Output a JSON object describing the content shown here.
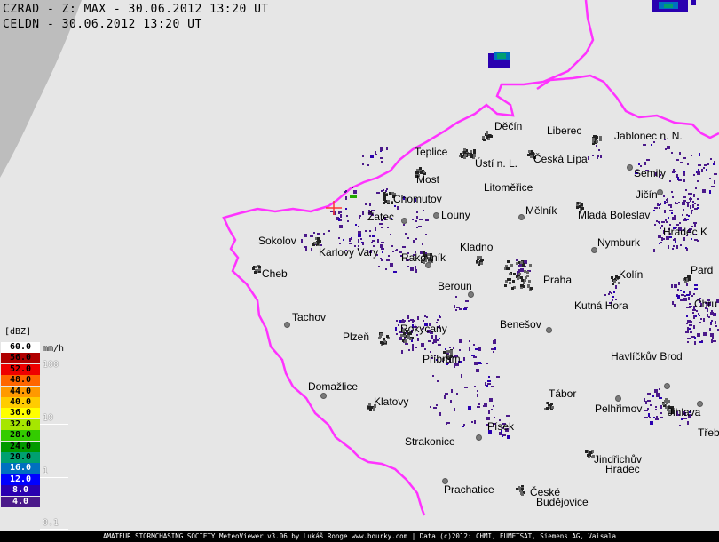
{
  "header": {
    "line1": "CZRAD - Z: MAX - 30.06.2012 13:20 UT",
    "line2": "CELDN - 30.06.2012 13:20 UT"
  },
  "colors": {
    "background": "#e6e6e6",
    "border": "#ff33ff",
    "precip_weak": "#4b1a8a",
    "city_fill": "#777777",
    "out_of_range": "#bdbdbd"
  },
  "legend": {
    "unit_dbz": "[dBZ]",
    "unit_rate": "mm/h",
    "scale": [
      {
        "label": "60.0",
        "color": "#ffffff",
        "text": "#000000"
      },
      {
        "label": "56.0",
        "color": "#b00000",
        "text": "#000000"
      },
      {
        "label": "52.0",
        "color": "#ee0000",
        "text": "#000000"
      },
      {
        "label": "48.0",
        "color": "#ff6600",
        "text": "#000000"
      },
      {
        "label": "44.0",
        "color": "#ff9900",
        "text": "#000000"
      },
      {
        "label": "40.0",
        "color": "#ffcc00",
        "text": "#000000"
      },
      {
        "label": "36.0",
        "color": "#ffff00",
        "text": "#000000"
      },
      {
        "label": "32.0",
        "color": "#a6e600",
        "text": "#000000"
      },
      {
        "label": "28.0",
        "color": "#33cc00",
        "text": "#000000"
      },
      {
        "label": "24.0",
        "color": "#009900",
        "text": "#000000"
      },
      {
        "label": "20.0",
        "color": "#00a070",
        "text": "#000000"
      },
      {
        "label": "16.0",
        "color": "#0070c0",
        "text": "#ffffff"
      },
      {
        "label": "12.0",
        "color": "#0000ff",
        "text": "#ffffff"
      },
      {
        "label": "8.0",
        "color": "#2a00b0",
        "text": "#ffffff"
      },
      {
        "label": "4.0",
        "color": "#4b1a8a",
        "text": "#ffffff"
      }
    ],
    "rates": [
      "100",
      "10",
      "1",
      "0.1"
    ]
  },
  "cities": [
    {
      "name": "Děčín"
    },
    {
      "name": "Liberec"
    },
    {
      "name": "Jablonec n. N."
    },
    {
      "name": "Teplice"
    },
    {
      "name": "Ústí n. L."
    },
    {
      "name": "Česká Lípa"
    },
    {
      "name": "Most"
    },
    {
      "name": "Semily"
    },
    {
      "name": "Chomutov"
    },
    {
      "name": "Litoměřice"
    },
    {
      "name": "Jičín"
    },
    {
      "name": "Žatec"
    },
    {
      "name": "Louny"
    },
    {
      "name": "Mělník"
    },
    {
      "name": "Mladá Boleslav"
    },
    {
      "name": "Hradec K"
    },
    {
      "name": "Sokolov"
    },
    {
      "name": "Karlovy Vary"
    },
    {
      "name": "Kladno"
    },
    {
      "name": "Nymburk"
    },
    {
      "name": "Rakovník"
    },
    {
      "name": "Pard"
    },
    {
      "name": "Cheb"
    },
    {
      "name": "Praha"
    },
    {
      "name": "Kolín"
    },
    {
      "name": "Beroun"
    },
    {
      "name": "Chru"
    },
    {
      "name": "Kutná Hora"
    },
    {
      "name": "Tachov"
    },
    {
      "name": "Benešov"
    },
    {
      "name": "Rokycany"
    },
    {
      "name": "Plzeň"
    },
    {
      "name": "Příbram"
    },
    {
      "name": "Havlíčkův Brod"
    },
    {
      "name": "Domažlice"
    },
    {
      "name": "Tábor"
    },
    {
      "name": "Klatovy"
    },
    {
      "name": "Pelhřimov"
    },
    {
      "name": "Jihlava"
    },
    {
      "name": "Strakonice"
    },
    {
      "name": "Písek"
    },
    {
      "name": "Třeb"
    },
    {
      "name": "Jindřichův"
    },
    {
      "name": "Hradec"
    },
    {
      "name": "Prachatice"
    },
    {
      "name": "České"
    },
    {
      "name": "Budějovice"
    }
  ],
  "footer": "AMATEUR STORMCHASING SOCIETY MeteoViewer v3.06 by Lukáš Ronge www.bourky.com | Data (c)2012: CHMI, EUMETSAT, Siemens AG, Vaisala"
}
